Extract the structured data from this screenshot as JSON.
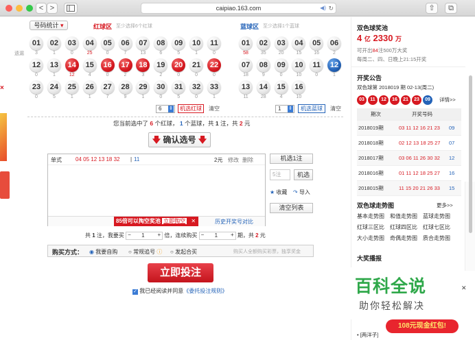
{
  "browser": {
    "url": "caipiao.163.com",
    "back": "<",
    "forward": ">",
    "traffic_colors": [
      "#fc605c",
      "#fdbc40",
      "#34c84a"
    ]
  },
  "selector": {
    "trend_button": "号码统计",
    "red_zone": "红球区",
    "red_hint": "至少选择6个红球",
    "blue_zone": "蓝球区",
    "blue_hint": "至少选择1个蓝球",
    "omission_label": "遗漏"
  },
  "red_balls": [
    {
      "n": "01",
      "m": "3",
      "on": false
    },
    {
      "n": "02",
      "m": "1",
      "on": false
    },
    {
      "n": "03",
      "m": "0",
      "on": false
    },
    {
      "n": "04",
      "m": "25",
      "on": false
    },
    {
      "n": "05",
      "m": "0",
      "on": false
    },
    {
      "n": "06",
      "m": "7",
      "on": false
    },
    {
      "n": "07",
      "m": "13",
      "on": false
    },
    {
      "n": "08",
      "m": "6",
      "on": false
    },
    {
      "n": "09",
      "m": "5",
      "on": false
    },
    {
      "n": "10",
      "m": "1",
      "on": false
    },
    {
      "n": "11",
      "m": "0",
      "on": false
    },
    {
      "n": "12",
      "m": "0",
      "on": false
    },
    {
      "n": "13",
      "m": "1",
      "on": false
    },
    {
      "n": "14",
      "m": "12",
      "on": true
    },
    {
      "n": "15",
      "m": "4",
      "on": false
    },
    {
      "n": "16",
      "m": "0",
      "on": true
    },
    {
      "n": "17",
      "m": "2",
      "on": true
    },
    {
      "n": "18",
      "m": "3",
      "on": true
    },
    {
      "n": "19",
      "m": "2",
      "on": false
    },
    {
      "n": "20",
      "m": "0",
      "on": true
    },
    {
      "n": "21",
      "m": "0",
      "on": false
    },
    {
      "n": "22",
      "m": "0",
      "on": true
    },
    {
      "n": "23",
      "m": "0",
      "on": false
    },
    {
      "n": "24",
      "m": "5",
      "on": false
    },
    {
      "n": "25",
      "m": "1",
      "on": false
    },
    {
      "n": "26",
      "m": "1",
      "on": false
    },
    {
      "n": "27",
      "m": "7",
      "on": false
    },
    {
      "n": "28",
      "m": "9",
      "on": false
    },
    {
      "n": "29",
      "m": "1",
      "on": false
    },
    {
      "n": "30",
      "m": "0",
      "on": false
    },
    {
      "n": "31",
      "m": "5",
      "on": false
    },
    {
      "n": "32",
      "m": "0",
      "on": false
    },
    {
      "n": "33",
      "m": "1",
      "on": false
    }
  ],
  "blue_balls": [
    {
      "n": "01",
      "m": "58",
      "on": false
    },
    {
      "n": "02",
      "m": "35",
      "on": false
    },
    {
      "n": "03",
      "m": "20",
      "on": false
    },
    {
      "n": "04",
      "m": "15",
      "on": false
    },
    {
      "n": "05",
      "m": "16",
      "on": false
    },
    {
      "n": "06",
      "m": "2",
      "on": false
    },
    {
      "n": "07",
      "m": "18",
      "on": false
    },
    {
      "n": "08",
      "m": "9",
      "on": false
    },
    {
      "n": "09",
      "m": "0",
      "on": false
    },
    {
      "n": "10",
      "m": "10",
      "on": false
    },
    {
      "n": "11",
      "m": "0",
      "on": false
    },
    {
      "n": "12",
      "m": "1",
      "on": true
    },
    {
      "n": "13",
      "m": "11",
      "on": false
    },
    {
      "n": "14",
      "m": "28",
      "on": false
    },
    {
      "n": "15",
      "m": "4",
      "on": false
    },
    {
      "n": "16",
      "m": "10",
      "on": false
    }
  ],
  "random": {
    "red_count": "6",
    "red_btn": "机选红球",
    "clear": "清空",
    "blue_count": "1",
    "blue_btn": "机选蓝球"
  },
  "summary": {
    "pre": "您当前选中了",
    "red_n": "6",
    "mid1": "个红球，",
    "blue_n": "1",
    "mid2": "个蓝球，共",
    "bets": "1",
    "mid3": "注，共",
    "amount": "2",
    "post": "元"
  },
  "confirm_btn": "确认选号",
  "list": {
    "type": "单式",
    "reds": "04 05 12 13 18 32",
    "sep": "|",
    "blue": "11",
    "price": "2元",
    "edit": "修改",
    "del": "删除",
    "promo": "85倍可以掏空奖池",
    "promo_link": "立即掏空",
    "history": "历史开奖号对比"
  },
  "right_btns": {
    "random1": "机选1注",
    "qty_placeholder": "5注",
    "random": "机选",
    "favorite": "收藏",
    "import": "导入",
    "clear_list": "清空列表"
  },
  "multiple": {
    "t1": "共",
    "bets": "1",
    "t2": "注，我要买",
    "mult": "1",
    "t3": "倍，连续购买",
    "issues": "1",
    "t4": "期，共",
    "amount": "2",
    "t5": "元"
  },
  "buy": {
    "label": "购买方式：",
    "opt1": "我要自购",
    "opt2": "常规追号",
    "opt3": "发起合买",
    "note": "购买人全额购买彩票，独享奖金",
    "submit": "立即投注",
    "agree": "我已经阅读并同意",
    "agree_link": "《委托投注规则》"
  },
  "sidebar": {
    "pool_title": "双色球奖池",
    "pool_amount": "4",
    "pool_yi": "亿",
    "pool_wan_n": "2330",
    "pool_wan": "万",
    "pool_line2a": "可开出",
    "pool_count": "84",
    "pool_line2b": "注500万大奖",
    "pool_line3": "每周二、四、日晚上21:15开奖",
    "notice_title": "开奖公告",
    "notice_issue": "双色球第 2018019 期  02-13(周二)",
    "notice_balls": [
      "03",
      "11",
      "12",
      "16",
      "21",
      "23"
    ],
    "notice_blue": "09",
    "detail": "详情>>",
    "col1": "期次",
    "col2": "开奖号码",
    "rows": [
      {
        "issue": "2018019期",
        "reds": "03 11 12 16 21 23",
        "blue": "09"
      },
      {
        "issue": "2018018期",
        "reds": "02 12 13 18 25 27",
        "blue": "07"
      },
      {
        "issue": "2018017期",
        "reds": "03 06 11 26 30 32",
        "blue": "12"
      },
      {
        "issue": "2018016期",
        "reds": "01 11 12 18 25 27",
        "blue": "16"
      },
      {
        "issue": "2018015期",
        "reds": "11 15 20 21 26 33",
        "blue": "15"
      }
    ],
    "trend_title": "双色球走势图",
    "more": "更多>>",
    "trend_links": [
      "基本走势图",
      "和值走势图",
      "蓝球走势图",
      "红球三区比",
      "红球四区比",
      "红球七区比",
      "大小走势图",
      "奇偶走势图",
      "质合走势图"
    ],
    "broadcast_title": "大奖播报",
    "broadcast_item": "• [两洋子]"
  },
  "watermark": {
    "big": "百科全说",
    "small": "助你轻松解决"
  },
  "ad": {
    "cash": "108元现金红包!"
  },
  "colors": {
    "red": "#d71921",
    "blue": "#2463b8"
  }
}
